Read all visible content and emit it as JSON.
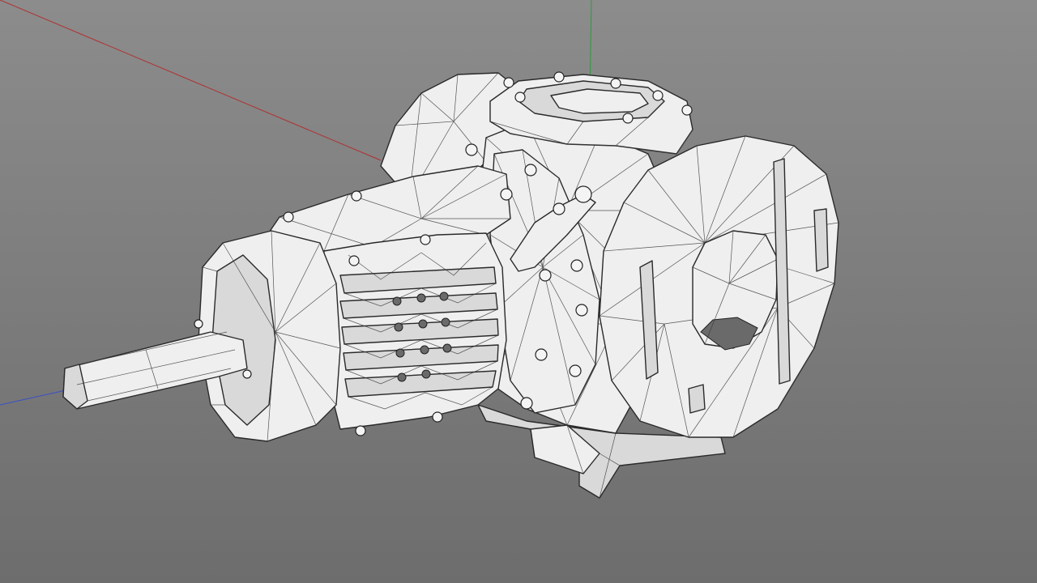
{
  "viewport": {
    "background_top": "#8c8c8c",
    "background_bottom": "#6d6d6d",
    "model": "gear-motor-wireframe"
  },
  "axes": {
    "x_color": "#b03030",
    "y_color": "#2e9a3e",
    "z_color": "#3a4fc8"
  }
}
